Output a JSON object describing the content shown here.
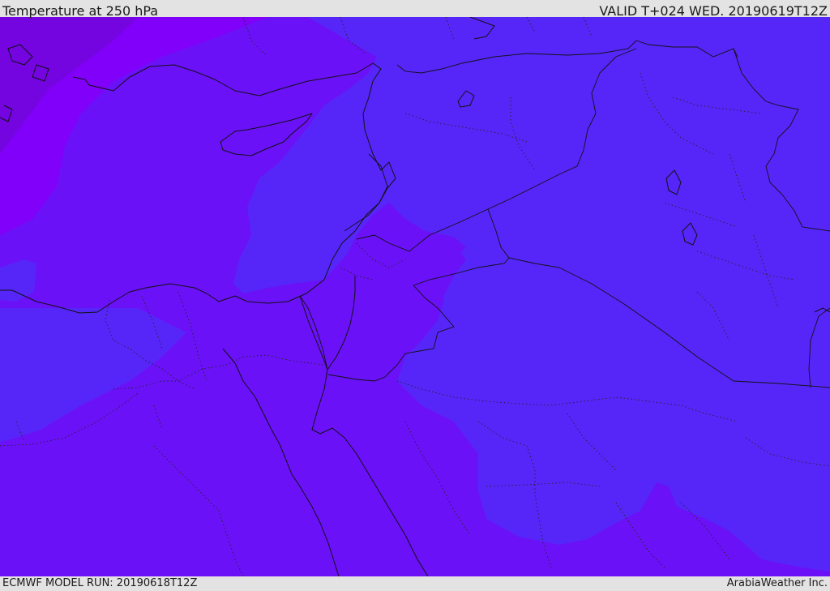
{
  "header": {
    "title": "Temperature at 250 hPa",
    "valid": "VALID T+024 WED. 20190619T12Z"
  },
  "footer": {
    "model_run": "ECMWF MODEL RUN: 20190618T12Z",
    "credit": "ArabiaWeather Inc."
  },
  "map": {
    "colors": {
      "base_violet": "#6b11f8",
      "warm_blue": "#5626f9",
      "bright_violet": "#8100f9",
      "deep_violet": "#7404e0"
    }
  }
}
